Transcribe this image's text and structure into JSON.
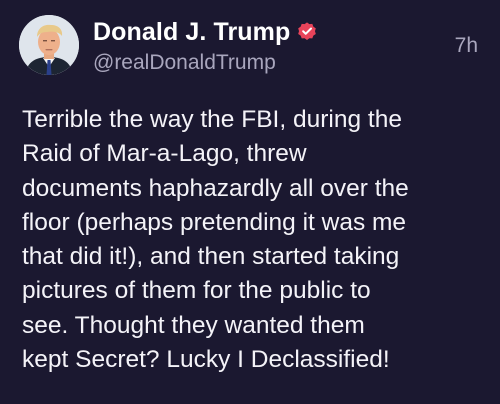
{
  "post": {
    "author": {
      "display_name": "Donald J. Trump",
      "handle": "@realDonaldTrump",
      "verified": true,
      "verified_icon": "verified-badge-icon",
      "avatar": "avatar-photo"
    },
    "timestamp": "7h",
    "text": "Terrible the way the FBI, during the\nRaid of Mar-a-Lago, threw\ndocuments haphazardly all over the\nfloor (perhaps pretending it was me\nthat did it!), and then started taking\npictures of them for the public to\nsee. Thought they wanted them\nkept Secret? Lucky I Declassified!"
  },
  "colors": {
    "background": "#1b1830",
    "primary_text": "#f4f3f8",
    "secondary_text": "#a9a6bd",
    "verified_badge": "#e8435a"
  }
}
